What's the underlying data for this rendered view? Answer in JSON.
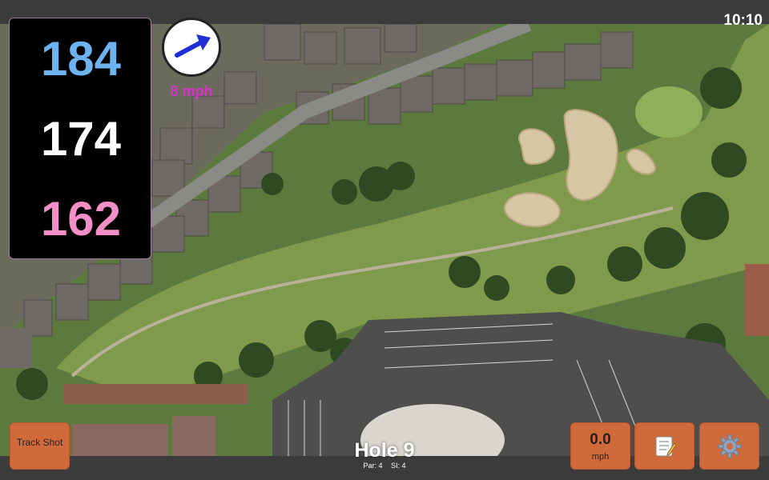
{
  "status": {
    "clock": "10:10"
  },
  "distances": {
    "back": "184",
    "middle": "174",
    "front": "162"
  },
  "wind": {
    "speed_label": "8 mph"
  },
  "buttons": {
    "track_shot_label": "Track Shot",
    "speed_value": "0.0",
    "speed_unit": "mph"
  },
  "hole": {
    "title": "Hole 9",
    "par": "Par: 4",
    "si": "SI: 4"
  },
  "icons": {
    "wind_direction": "arrow-icon",
    "notes": "notepad-icon",
    "settings": "gear-icon"
  },
  "colors": {
    "back_distance": "#6db3ef",
    "middle_distance": "#ffffff",
    "front_distance": "#f28fc6",
    "wind_text": "#d832c8",
    "button": "#d06a3b"
  }
}
